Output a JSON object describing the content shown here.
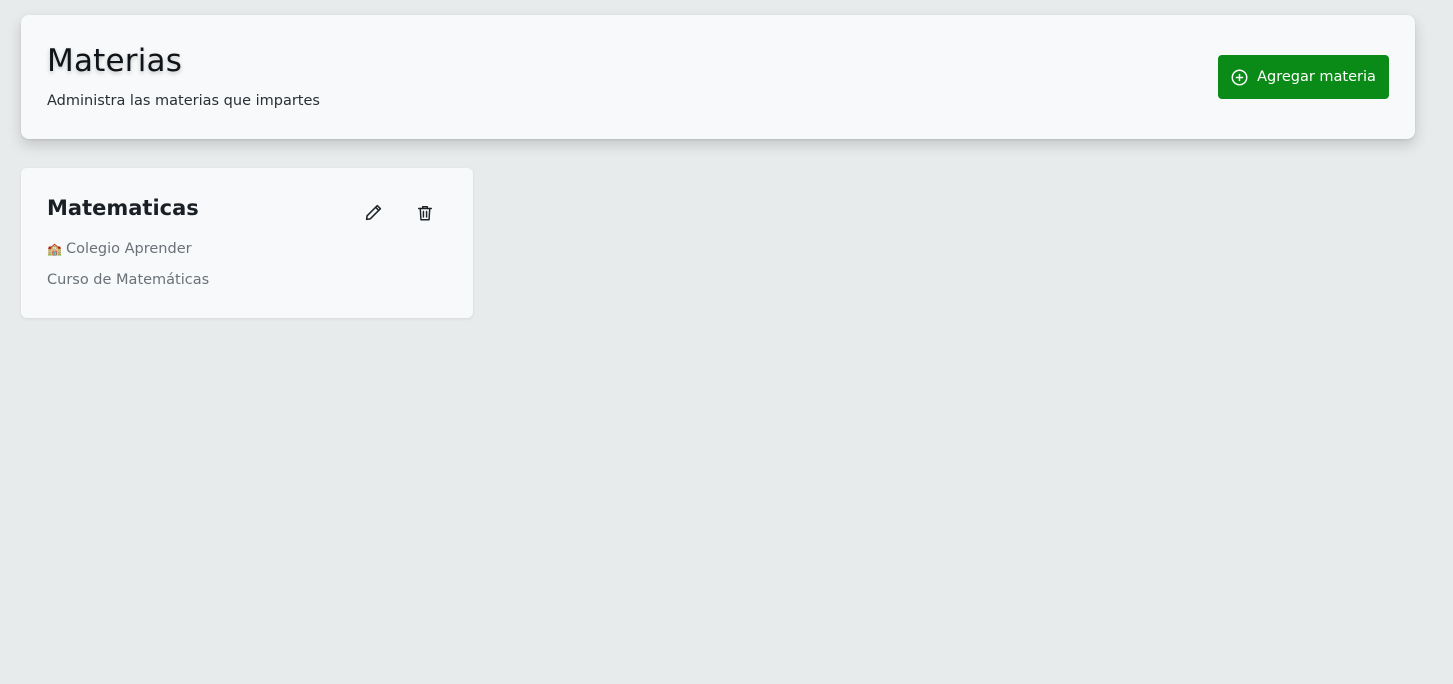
{
  "header": {
    "title": "Materias",
    "subtitle": "Administra las materias que impartes",
    "add_button_label": "Agregar materia",
    "add_button_icon": "plus-circle-icon",
    "accent_color": "#0a8a16"
  },
  "subjects": [
    {
      "name": "Matematicas",
      "school_icon": "school-building-icon",
      "school_glyph": "🏫",
      "school": "Colegio Aprender",
      "description": "Curso de Matemáticas",
      "edit_icon": "pencil-icon",
      "delete_icon": "trash-icon"
    }
  ]
}
